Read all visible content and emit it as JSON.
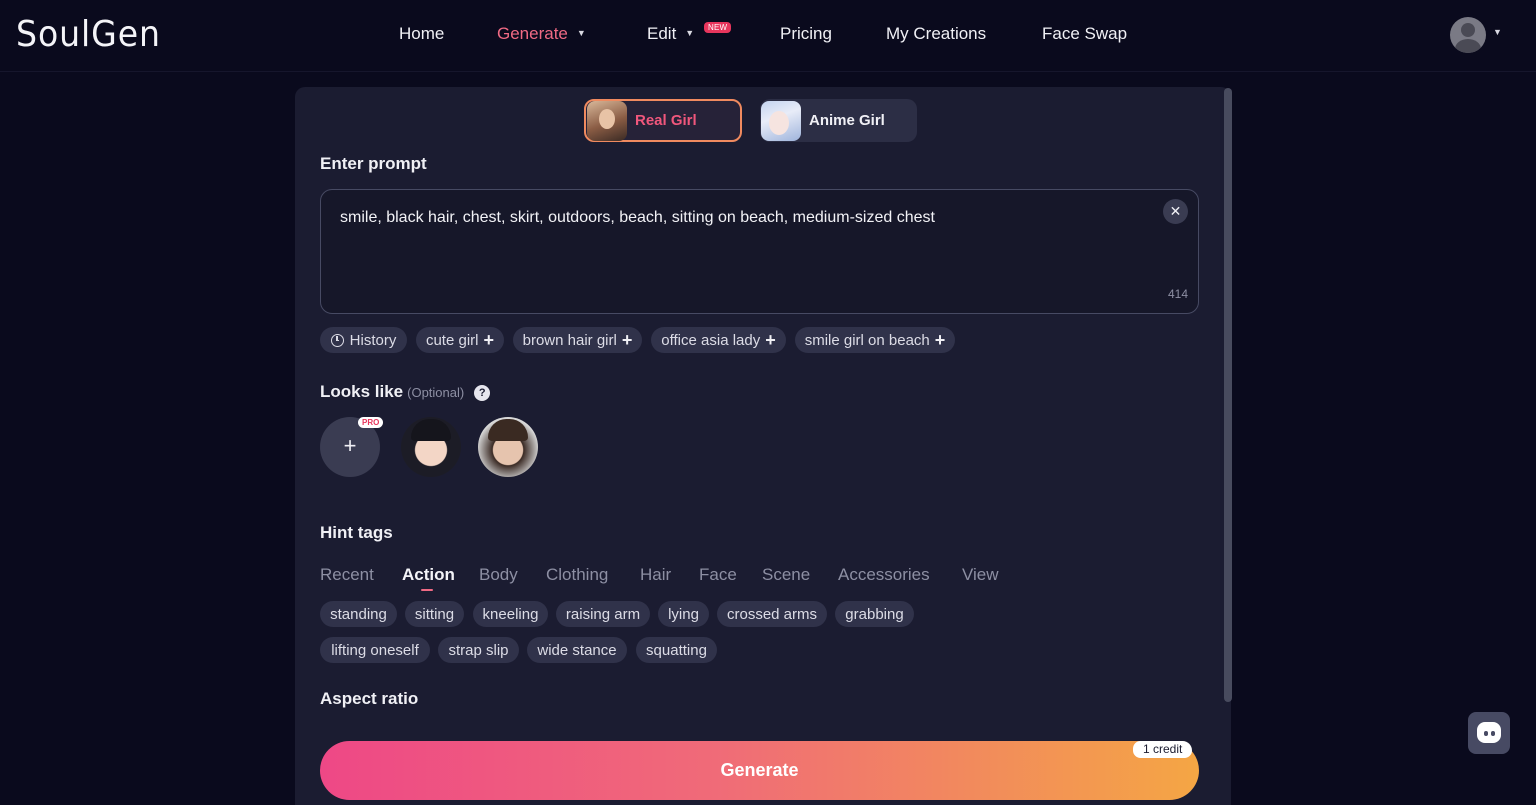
{
  "header": {
    "logo": "SoulGen",
    "nav": [
      {
        "label": "Home"
      },
      {
        "label": "Generate"
      },
      {
        "label": "Edit",
        "badge": "NEW"
      },
      {
        "label": "Pricing"
      },
      {
        "label": "My Creations"
      },
      {
        "label": "Face Swap"
      }
    ],
    "active_nav": "Generate",
    "accent_color": "#f06a84",
    "avatar_icon": "user-avatar-icon"
  },
  "type_toggle": {
    "options": [
      {
        "label": "Real Girl",
        "selected": true
      },
      {
        "label": "Anime Girl",
        "selected": false
      }
    ]
  },
  "prompt": {
    "label": "Enter prompt",
    "value": "smile, black hair, chest, skirt, outdoors, beach, sitting on beach, medium-sized chest",
    "char_count": "414",
    "clear_icon": "close-icon"
  },
  "suggestions": {
    "history_label": "History",
    "chips": [
      "cute girl",
      "brown hair girl",
      "office asia lady",
      "smile girl on beach"
    ]
  },
  "looks_like": {
    "label": "Looks like",
    "optional": "(Optional)",
    "help": "?",
    "add_symbol": "+",
    "pro_badge": "PRO"
  },
  "hint_tags": {
    "label": "Hint tags",
    "tabs": [
      "Recent",
      "Action",
      "Body",
      "Clothing",
      "Hair",
      "Face",
      "Scene",
      "Accessories",
      "View"
    ],
    "active_tab": "Action",
    "tags": [
      "standing",
      "sitting",
      "kneeling",
      "raising arm",
      "lying",
      "crossed arms",
      "grabbing",
      "lifting oneself",
      "strap slip",
      "wide stance",
      "squatting"
    ]
  },
  "aspect_ratio": {
    "label": "Aspect ratio"
  },
  "generate": {
    "label": "Generate",
    "credit": "1 credit"
  },
  "colors": {
    "background": "#0a0a1d",
    "panel": "#1b1c31",
    "gradient_start": "#ee4886",
    "gradient_end": "#f4a644"
  }
}
